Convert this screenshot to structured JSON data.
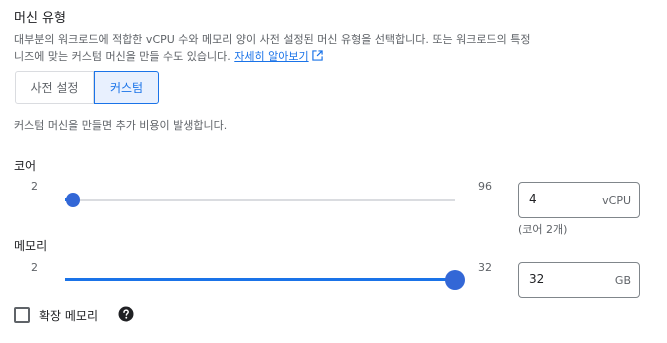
{
  "machine_type": {
    "title": "머신 유형",
    "description": "대부분의 워크로드에 적합한 vCPU 수와 메모리 양이 사전 설정된 머신 유형을 선택합니다. 또는 워크로드의 특정 니즈에 맞는 커스텀 머신을 만들 수도 있습니다.",
    "learn_more": "자세히 알아보기",
    "tabs": [
      {
        "label": "사전 설정",
        "active": false
      },
      {
        "label": "커스텀",
        "active": true
      }
    ],
    "cost_note": "커스텀 머신을 만들면 추가 비용이 발생합니다."
  },
  "cores": {
    "label": "코어",
    "min": "2",
    "max": "96",
    "value": 4,
    "input_value": "4",
    "unit": "vCPU",
    "hint": "(코어 2개)"
  },
  "memory": {
    "label": "메모리",
    "min": "2",
    "max": "32",
    "value": 32,
    "input_value": "32",
    "unit": "GB"
  },
  "extended_memory": {
    "label": "확장 메모리",
    "checked": false,
    "help_icon": "help-circle-icon"
  },
  "colors": {
    "accent": "#1a73e8",
    "thumb": "#3367d6"
  }
}
